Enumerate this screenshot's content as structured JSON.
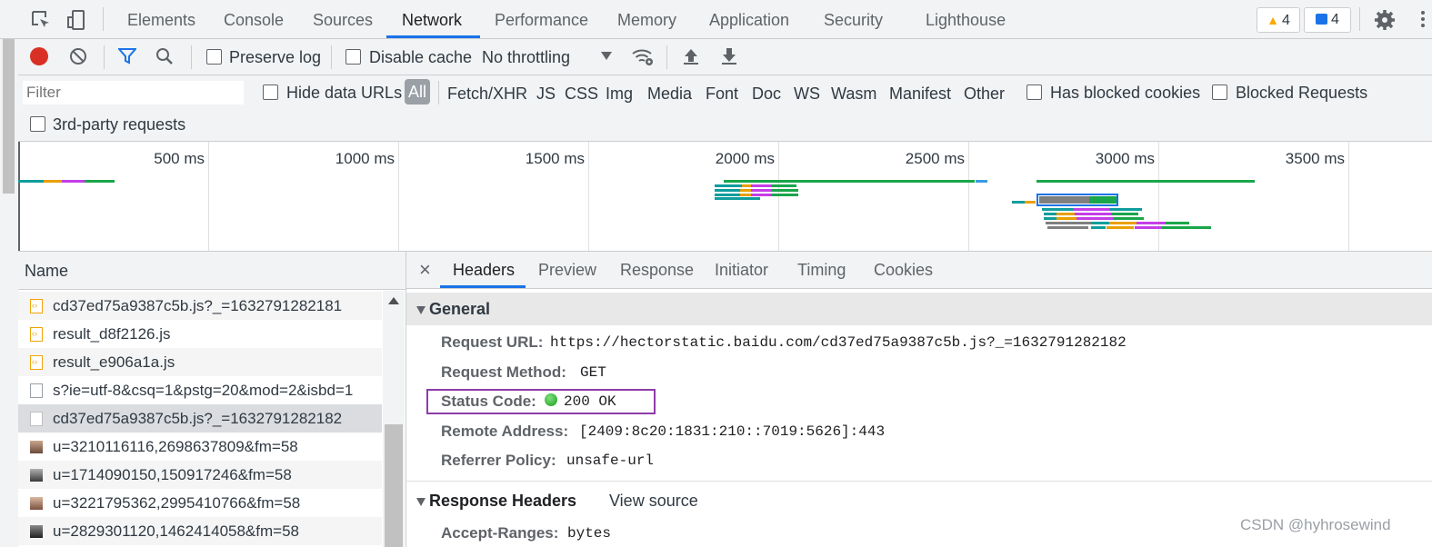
{
  "panel_tabs": [
    "Elements",
    "Console",
    "Sources",
    "Network",
    "Performance",
    "Memory",
    "Application",
    "Security",
    "Lighthouse"
  ],
  "active_panel": "Network",
  "badges": {
    "warnings": "4",
    "messages": "4"
  },
  "colors": {
    "accent": "#1a73e8",
    "record": "#d93025",
    "warn": "#f9ab00",
    "highlight": "#8e3ca8"
  },
  "toolbar": {
    "preserve_log": "Preserve log",
    "disable_cache": "Disable cache",
    "throttling": "No throttling"
  },
  "filterbar": {
    "placeholder": "Filter",
    "hide_data_urls": "Hide data URLs",
    "types": [
      "All",
      "Fetch/XHR",
      "JS",
      "CSS",
      "Img",
      "Media",
      "Font",
      "Doc",
      "WS",
      "Wasm",
      "Manifest",
      "Other"
    ],
    "has_blocked_cookies": "Has blocked cookies",
    "blocked_requests": "Blocked Requests",
    "third_party": "3rd-party requests"
  },
  "overview": {
    "ticks": [
      "500 ms",
      "1000 ms",
      "1500 ms",
      "2000 ms",
      "2500 ms",
      "3000 ms",
      "3500 ms"
    ]
  },
  "requests": {
    "header": "Name",
    "rows": [
      {
        "name": "cd37ed75a9387c5b.js?_=1632791282181",
        "icon": "js-file-icon"
      },
      {
        "name": "result_d8f2126.js",
        "icon": "js-file-icon"
      },
      {
        "name": "result_e906a1a.js",
        "icon": "js-file-icon"
      },
      {
        "name": "s?ie=utf-8&csq=1&pstg=20&mod=2&isbd=1",
        "icon": "document-icon"
      },
      {
        "name": "cd37ed75a9387c5b.js?_=1632791282182",
        "icon": "js-file-icon"
      },
      {
        "name": "u=3210116116,2698637809&fm=58",
        "icon": "image-thumb-icon"
      },
      {
        "name": "u=1714090150,150917246&fm=58",
        "icon": "image-thumb-icon"
      },
      {
        "name": "u=3221795362,2995410766&fm=58",
        "icon": "image-thumb-icon"
      },
      {
        "name": "u=2829301120,1462414058&fm=58",
        "icon": "image-thumb-icon"
      }
    ]
  },
  "detail": {
    "close": "×",
    "tabs": [
      "Headers",
      "Preview",
      "Response",
      "Initiator",
      "Timing",
      "Cookies"
    ],
    "general": {
      "title": "General",
      "request_url_label": "Request URL:",
      "request_url": "https://hectorstatic.baidu.com/cd37ed75a9387c5b.js?_=1632791282182",
      "request_method_label": "Request Method:",
      "request_method": "GET",
      "status_code_label": "Status Code:",
      "status_code": "200 OK",
      "remote_address_label": "Remote Address:",
      "remote_address": "[2409:8c20:1831:210::7019:5626]:443",
      "referrer_policy_label": "Referrer Policy:",
      "referrer_policy": "unsafe-url"
    },
    "response_headers": {
      "title": "Response Headers",
      "view_source": "View source",
      "accept_ranges_label": "Accept-Ranges:",
      "accept_ranges": "bytes"
    }
  },
  "watermark": "CSDN @hyhrosewind"
}
